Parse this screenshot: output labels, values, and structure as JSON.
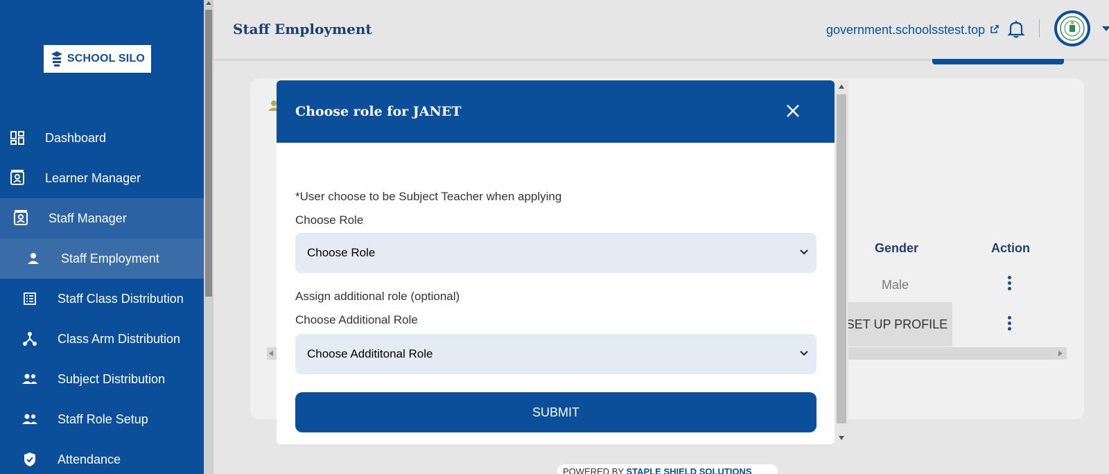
{
  "sidebar": {
    "logo_text": "SCHOOL SILO",
    "items": [
      {
        "label": "Dashboard",
        "icon": "dashboard-icon"
      },
      {
        "label": "Learner Manager",
        "icon": "contact-card-icon"
      },
      {
        "label": "Staff Manager",
        "icon": "contact-card-icon"
      },
      {
        "label": "Staff Employment",
        "icon": "person-icon"
      },
      {
        "label": "Staff Class Distribution",
        "icon": "list-icon"
      },
      {
        "label": "Class Arm Distribution",
        "icon": "branch-icon"
      },
      {
        "label": "Subject Distribution",
        "icon": "people-icon"
      },
      {
        "label": "Staff Role Setup",
        "icon": "people-icon"
      },
      {
        "label": "Attendance",
        "icon": "shield-check-icon"
      }
    ]
  },
  "header": {
    "title": "Staff Employment",
    "domain": "government.schoolsstest.top"
  },
  "table": {
    "columns": [
      "Gender",
      "Action"
    ],
    "rows": [
      {
        "gender": "Male"
      },
      {
        "gender": "SET UP PROFILE"
      }
    ]
  },
  "footer": {
    "prefix": "POWERED BY",
    "brand": "STAPLE SHIELD SOLUTIONS"
  },
  "modal": {
    "title": "Choose role for JANET",
    "note": "*User choose to be Subject Teacher when applying",
    "role_label": "Choose Role",
    "role_value": "Choose Role",
    "additional_heading": "Assign additional role (optional)",
    "additional_label": "Choose Additional Role",
    "additional_value": "Choose Addititonal Role",
    "submit_label": "SUBMIT"
  },
  "colors": {
    "primary": "#0b4f9a",
    "sidebar_active": "#3a6ca8",
    "select_bg": "#e4ebf4"
  }
}
